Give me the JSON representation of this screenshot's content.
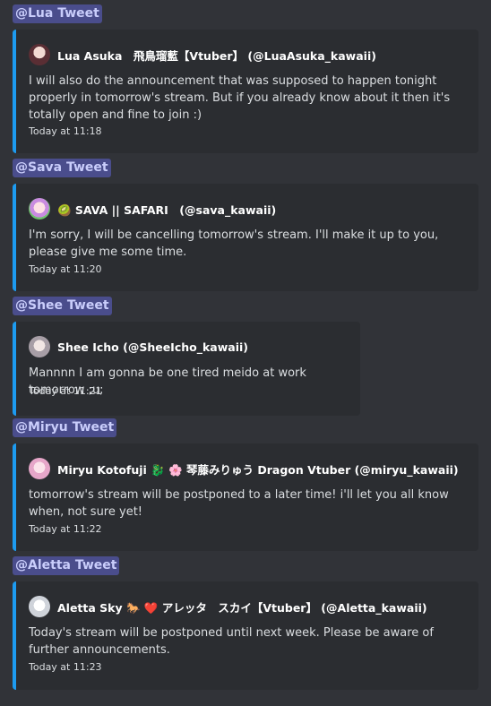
{
  "messages": [
    {
      "mention": "@Lua Tweet",
      "author": "Lua Asuka　飛鳥瑠藍【Vtuber】 (@LuaAsuka_kawaii)",
      "avatar_icon": "lua-avatar",
      "description": "I will also do the announcement that was supposed to happen tonight properly in tomorrow's stream. But if you already know about it then it's totally open and fine to join :)",
      "timestamp": "Today at 11:18"
    },
    {
      "mention": "@Sava Tweet",
      "author": "🥝 SAVA || SAFARI　(@sava_kawaii)",
      "avatar_icon": "sava-avatar",
      "description": "I'm sorry, I will be cancelling tomorrow's stream. I'll make it up to you, please give me some time.",
      "timestamp": "Today at 11:20"
    },
    {
      "mention": "@Shee Tweet",
      "author": "Shee Icho (@SheeIcho_kawaii)",
      "avatar_icon": "shee-avatar",
      "description": "Mannnn I am gonna be one tired meido at work tomorrow ;u;",
      "timestamp": "Today at 11:21"
    },
    {
      "mention": "@Miryu Tweet",
      "author": "Miryu Kotofuji 🐉 🌸 琴藤みりゅう Dragon Vtuber (@miryu_kawaii)",
      "avatar_icon": "miryu-avatar",
      "description": "tomorrow's stream will be postponed to a later time! i'll let you all know when, not sure yet!",
      "timestamp": "Today at 11:22"
    },
    {
      "mention": "@Aletta Tweet",
      "author": "Aletta Sky 🐎 ❤️ アレッタ　スカイ【Vtuber】 (@Aletta_kawaii)",
      "avatar_icon": "aletta-avatar",
      "description": "Today's stream will be postponed until next week. Please be aware of further announcements.",
      "timestamp": "Today at 11:23"
    }
  ],
  "colors": {
    "background": "#313338",
    "embed_bg": "#2b2d31",
    "embed_border": "#1d9bf0",
    "mention_bg": "#4a4d8c",
    "mention_text": "#c9cdfb"
  }
}
